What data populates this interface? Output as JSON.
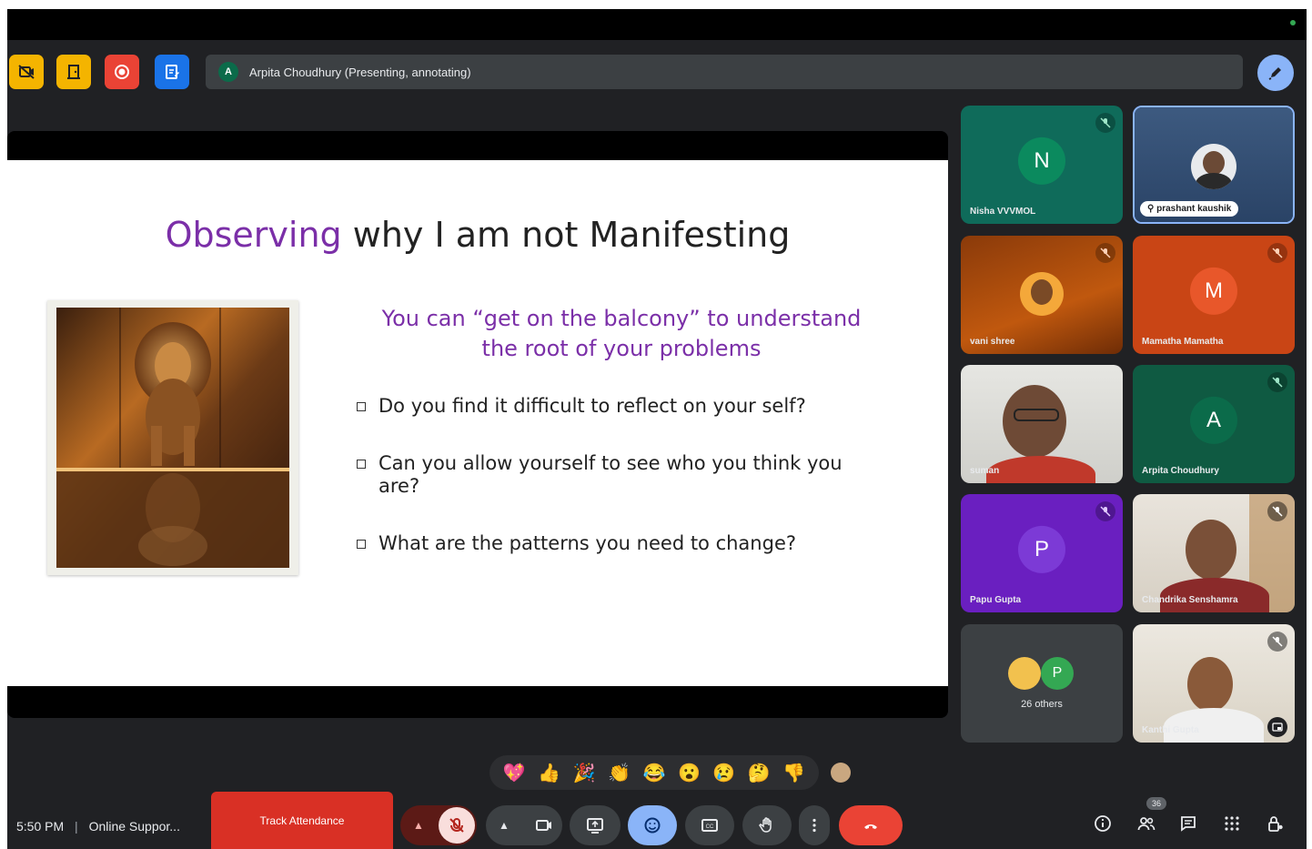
{
  "toolbar": {
    "presenter_initial": "A",
    "presenter_text": "Arpita Choudhury (Presenting, annotating)"
  },
  "slide": {
    "title_highlight": "Observing",
    "title_rest": " why I am not Manifesting",
    "subtitle_line1": "You can “get on the balcony” to understand",
    "subtitle_line2": "the root of your problems",
    "bullets": [
      "Do you find it difficult to reflect on your self?",
      "Can you allow yourself to see who you think you are?",
      "What are the patterns you need to change?"
    ]
  },
  "participants": [
    {
      "initial": "N",
      "name": "Nisha VVVMOL",
      "bg": "#0f6b5a",
      "avatar": "#0b8a5e"
    },
    {
      "name": "prashant kaushik"
    },
    {
      "name": "vani shree"
    },
    {
      "initial": "M",
      "name": "Mamatha Mamatha",
      "bg": "#c94515",
      "avatar": "#e8572a"
    },
    {
      "name": "suman"
    },
    {
      "initial": "A",
      "name": "Arpita Choudhury",
      "bg": "#0f6b4a",
      "avatar": "#0b6b4a"
    },
    {
      "initial": "P",
      "name": "Papu Gupta",
      "bg": "#6a1fc0",
      "avatar": "#7c3ad6"
    },
    {
      "name": "Chandrika Senshamra"
    },
    {
      "others_text": "26 others",
      "initial": "P"
    },
    {
      "name": "Kanthi Gupta"
    }
  ],
  "reactions": [
    "💖",
    "👍",
    "🎉",
    "👏",
    "😂",
    "😮",
    "😢",
    "🤔",
    "👎"
  ],
  "bottom": {
    "time": "5:50 PM",
    "separator": "|",
    "meeting_title": "Online Suppor...",
    "track_label": "Track Attendance",
    "people_count": "36"
  },
  "colors": {
    "accent": "#8ab4f8",
    "end_call": "#ea4335",
    "track": "#d93025"
  }
}
